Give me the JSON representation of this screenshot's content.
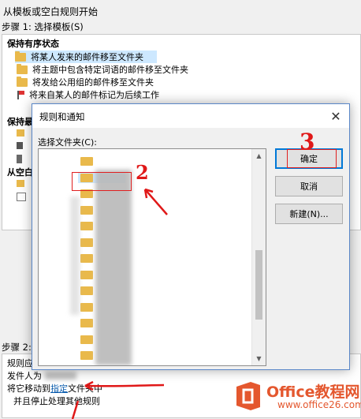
{
  "wizard": {
    "title": "从模板或空白规则开始",
    "step1": "步骤 1: 选择模板(S)",
    "step2": "步骤 2:",
    "sections": [
      "保持有序状态",
      "保持最",
      "从空白"
    ],
    "templates": [
      {
        "label": "将某人发来的邮件移至文件夹",
        "icon": "folder-icon",
        "selected": true
      },
      {
        "label": "将主题中包含特定词语的邮件移至文件夹",
        "icon": "folder-icon",
        "selected": false
      },
      {
        "label": "将发给公用组的邮件移至文件夹",
        "icon": "folder-icon",
        "selected": false
      },
      {
        "label": "将来自某人的邮件标记为后续工作",
        "icon": "flag-icon",
        "selected": false
      }
    ],
    "rule_lines": {
      "l1": "规则应",
      "l2": "发件人为",
      "l3a": "将它移动到",
      "l3link": "指定",
      "l3b": "文件夹中",
      "l4": "并且停止处理其他规则"
    }
  },
  "dialog": {
    "title": "规则和通知",
    "close_glyph": "✕",
    "folder_label": "选择文件夹(C):",
    "ok_label": "确定",
    "cancel_label": "取消",
    "new_label": "新建(N)...",
    "folder_count": 13,
    "selected_folder_index": 1
  },
  "annotations": {
    "n2": "2",
    "n3": "3",
    "color": "#e01818"
  },
  "watermark": {
    "line1": "Office教程网",
    "line2": "www.office26.com",
    "color": "#e4572e"
  }
}
